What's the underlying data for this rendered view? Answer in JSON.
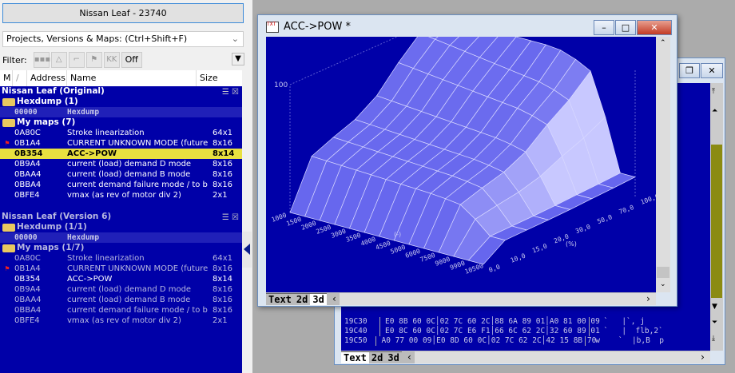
{
  "project_button": "Nissan Leaf - 23740",
  "search_combo": "Projects, Versions & Maps:  (Ctrl+Shift+F)",
  "filter": {
    "label": "Filter:",
    "off_label": "Off"
  },
  "columns": {
    "m": "M",
    "sort": "/",
    "address": "Address",
    "name": "Name",
    "size": "Size"
  },
  "groups": [
    {
      "title": "Nissan Leaf (Original)",
      "hexdump_folder": "Hexdump (1)",
      "hexdump": {
        "addr": "00000",
        "name": "Hexdump"
      },
      "maps_folder": "My maps (7)",
      "maps": [
        {
          "addr": "0A80C",
          "name": "Stroke linearization",
          "size": "64x1",
          "flag": false
        },
        {
          "addr": "0B1A4",
          "name": "CURRENT UNKNOWN MODE (future",
          "size": "8x16",
          "flag": true
        },
        {
          "addr": "0B354",
          "name": "ACC->POW",
          "size": "8x14",
          "flag": false,
          "selected": true
        },
        {
          "addr": "0B9A4",
          "name": "current (load) demand D mode",
          "size": "8x16",
          "flag": false
        },
        {
          "addr": "0BAA4",
          "name": "current (load) demand B mode",
          "size": "8x16",
          "flag": false
        },
        {
          "addr": "0BBA4",
          "name": "current demand failure mode / to b",
          "size": "8x16",
          "flag": false
        },
        {
          "addr": "0BFE4",
          "name": "vmax (as rev of motor div 2)",
          "size": "2x1",
          "flag": false
        }
      ]
    },
    {
      "title": "Nissan Leaf (Version 6)",
      "hexdump_folder": "Hexdump (1/1)",
      "hexdump": {
        "addr": "00000",
        "name": "Hexdump"
      },
      "maps_folder": "My maps (1/7)",
      "maps": [
        {
          "addr": "0A80C",
          "name": "Stroke linearization",
          "size": "64x1",
          "flag": false
        },
        {
          "addr": "0B1A4",
          "name": "CURRENT UNKNOWN MODE (future",
          "size": "8x16",
          "flag": true
        },
        {
          "addr": "0B354",
          "name": "ACC->POW",
          "size": "8x14",
          "flag": false,
          "selected": true
        },
        {
          "addr": "0B9A4",
          "name": "current (load) demand D mode",
          "size": "8x16",
          "flag": false
        },
        {
          "addr": "0BAA4",
          "name": "current (load) demand B mode",
          "size": "8x16",
          "flag": false
        },
        {
          "addr": "0BBA4",
          "name": "current demand failure mode / to b",
          "size": "8x16",
          "flag": false
        },
        {
          "addr": "0BFE4",
          "name": "vmax (as rev of motor div 2)",
          "size": "2x1",
          "flag": false
        }
      ]
    }
  ],
  "map_window": {
    "title": "ACC->POW *",
    "tabs": [
      "Text",
      "2d",
      "3d"
    ],
    "active_tab": "3d",
    "chart": {
      "z_label": "100",
      "rpm_axis": [
        "1000",
        "1500",
        "2000",
        "2500",
        "3000",
        "3500",
        "4000",
        "4500",
        "5000",
        "6000",
        "7500",
        "9000",
        "9900",
        "10500"
      ],
      "pedal_axis": [
        "0,0",
        "10,0",
        "15,0",
        "20,0",
        "30,0",
        "50,0",
        "70,0",
        "100,0"
      ],
      "pedal_unit": "(%)",
      "rpm_unit": "(-)"
    }
  },
  "hex_window": {
    "tabs": [
      "Text",
      "2d",
      "3d"
    ],
    "active_tab": "Text",
    "rows": [
      {
        "addr": "19C30",
        "bytes": "E0 8B 60 0C│02 7C 60 2C│88 6A 89 01│A0 81 00 09",
        "ascii": "  `   |`, j"
      },
      {
        "addr": "19C40",
        "bytes": "E0 8C 60 0C│02 7C E6 F1│66 6C 62 2C│32 60 89 01",
        "ascii": "  `   |  flb,2`"
      },
      {
        "addr": "19C50",
        "bytes": "A0 77 00 09│E0 8D 60 0C│02 7C 62 2C│42 15 8B 70",
        "ascii": " w    `  |b,B  p"
      }
    ]
  }
}
